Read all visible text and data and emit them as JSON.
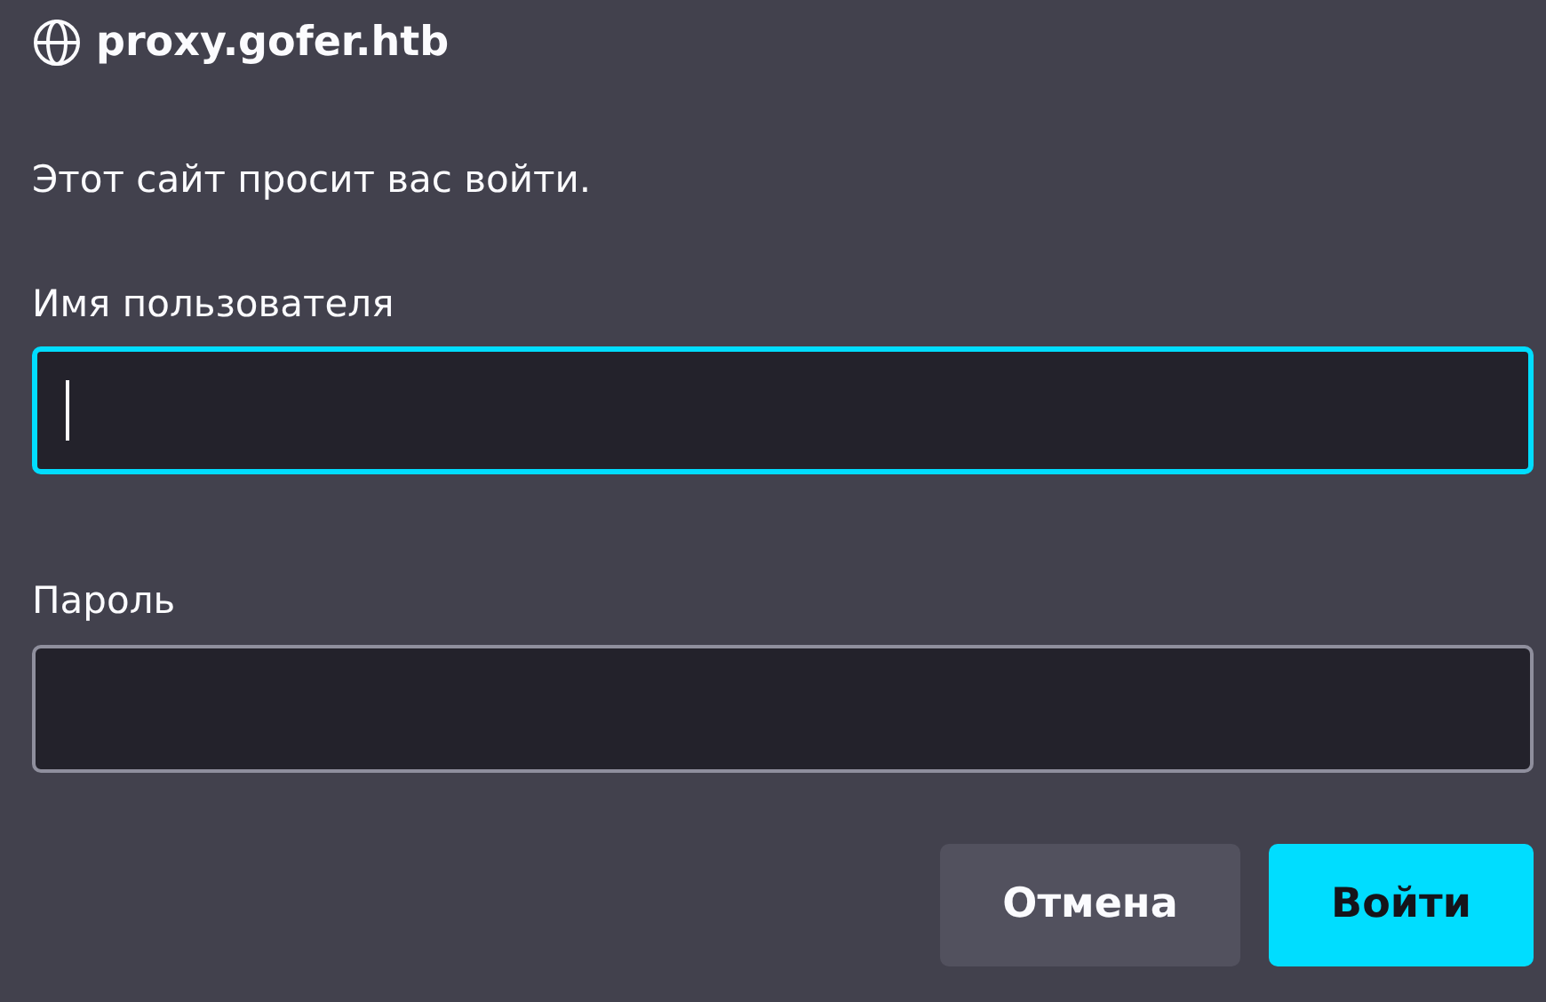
{
  "dialog": {
    "site": "proxy.gofer.htb",
    "message": "Этот сайт просит вас войти."
  },
  "fields": [
    {
      "label": "Имя пользователя",
      "focused": true
    },
    {
      "label": "Пароль",
      "focused": false
    }
  ],
  "buttons": [
    {
      "label": "Отмена",
      "primary": false
    },
    {
      "label": "Войти",
      "primary": true
    }
  ]
}
